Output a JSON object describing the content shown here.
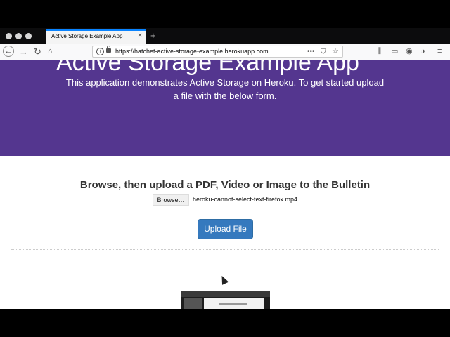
{
  "browser": {
    "tab_title": "Active Storage Example App",
    "tab_close": "×",
    "new_tab": "+",
    "url": "https://hatchet-active-storage-example.herokuapp.com",
    "icons": [
      "back-icon",
      "forward-icon",
      "reload-icon",
      "home-icon",
      "info-icon",
      "lock-icon",
      "more-icon",
      "pocket-icon",
      "star-icon",
      "library-icon",
      "sidebar-icon",
      "account-icon",
      "extension-icon",
      "menu-icon"
    ]
  },
  "hero": {
    "title": "Active Storage Example App",
    "description": "This application demonstrates Active Storage on Heroku. To get started upload a file with the below form."
  },
  "upload": {
    "heading": "Browse, then upload a PDF, Video or Image to the Bulletin",
    "browse_label": "Browse…",
    "selected_file": "heroku-cannot-select-text-firefox.mp4",
    "submit_label": "Upload File"
  },
  "colors": {
    "hero_bg": "#54368f",
    "upload_button_bg": "#3579be",
    "tab_accent": "#0a84ff"
  }
}
